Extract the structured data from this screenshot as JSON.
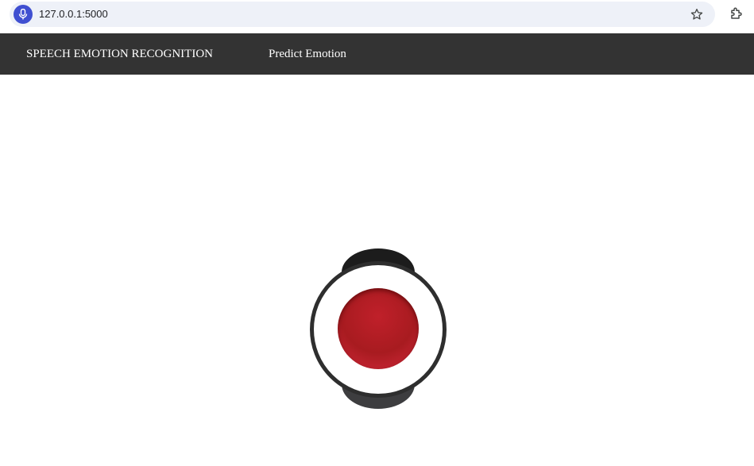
{
  "browser": {
    "url": "127.0.0.1:5000",
    "site_icon": "microphone-icon",
    "bookmark_icon": "star-icon",
    "extensions_icon": "puzzle-piece-icon"
  },
  "navbar": {
    "brand": "SPEECH EMOTION RECOGNITION",
    "links": [
      "Predict Emotion"
    ]
  },
  "recorder": {
    "button_icon": "record-icon",
    "accent_color": "#b81f2a"
  },
  "colors": {
    "navbar_bg": "#333333",
    "site_icon_bg": "#3f4fd1"
  }
}
